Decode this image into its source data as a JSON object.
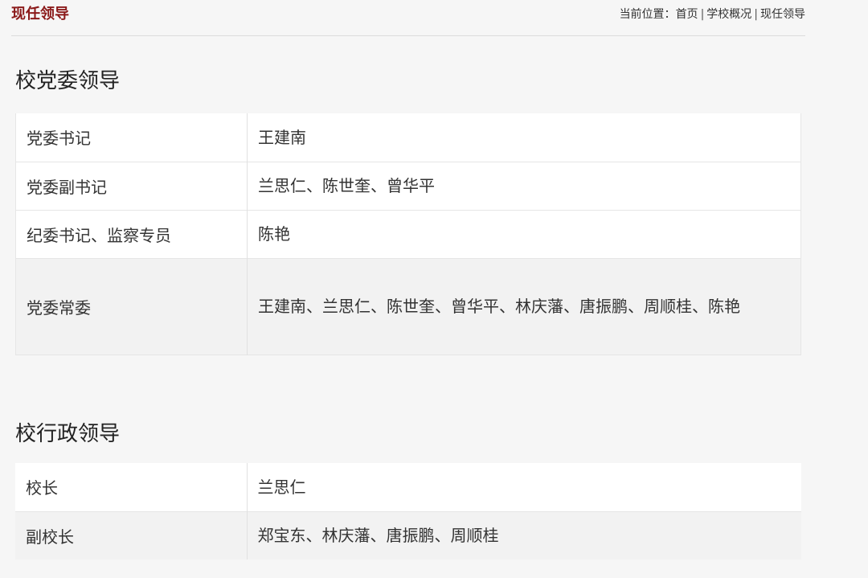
{
  "header": {
    "title": "现任领导",
    "breadcrumb": {
      "prefix": "当前位置：",
      "items": [
        "首页",
        "学校概况",
        "现任领导"
      ],
      "separator": "|"
    }
  },
  "party_section": {
    "heading": "校党委领导",
    "rows": [
      {
        "role": "党委书记",
        "names": "王建南"
      },
      {
        "role": "党委副书记",
        "names": "兰思仁、陈世奎、曾华平"
      },
      {
        "role": "纪委书记、监察专员",
        "names": "陈艳"
      },
      {
        "role": "党委常委",
        "names": "王建南、兰思仁、陈世奎、曾华平、林庆藩、唐振鹏、周顺桂、陈艳"
      }
    ]
  },
  "admin_section": {
    "heading": "校行政领导",
    "rows": [
      {
        "role": "校长",
        "names": "兰思仁"
      },
      {
        "role": "副校长",
        "names": "郑宝东、林庆藩、唐振鹏、周顺桂"
      }
    ]
  },
  "colors": {
    "title_red": "#8b1a1a",
    "page_background": "#f6f6f6",
    "row_white": "#ffffff",
    "row_grey": "#f2f2f2"
  }
}
